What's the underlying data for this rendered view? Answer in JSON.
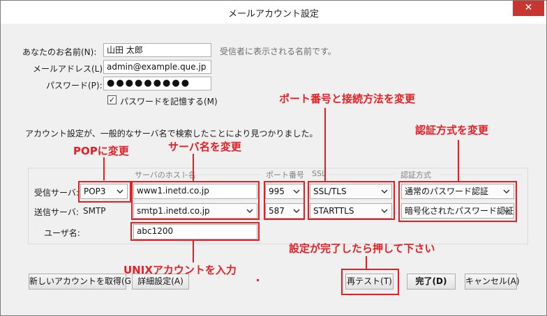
{
  "window": {
    "title": "メールアカウント設定",
    "close_glyph": "✕"
  },
  "identity": {
    "name_label": "あなたのお名前(N):",
    "name_value": "山田 太郎",
    "name_hint": "受信者に表示される名前です。",
    "email_label": "メールアドレス(L):",
    "email_value": "admin@example.que.jp",
    "password_label": "パスワード(P):",
    "password_value": "●●●●●●●●●",
    "remember_label": "パスワードを記憶する(M)",
    "remember_checked": true
  },
  "info_text": "アカウント設定が、一般的なサーバ名で検索したことにより見つかりました。",
  "server_table": {
    "headers": {
      "host": "サーバのホスト名",
      "port": "ポート番号",
      "ssl": "SSL",
      "auth": "認証方式"
    },
    "incoming": {
      "label": "受信サーバ:",
      "protocol": "POP3",
      "host": "www1.inetd.co.jp",
      "port": "995",
      "ssl": "SSL/TLS",
      "auth": "通常のパスワード認証"
    },
    "outgoing": {
      "label": "送信サーバ:",
      "protocol": "SMTP",
      "host": "smtp1.inetd.co.jp",
      "port": "587",
      "ssl": "STARTTLS",
      "auth": "暗号化されたパスワード認証"
    },
    "username_label": "ユーザ名:",
    "username_value": "abc1200"
  },
  "buttons": {
    "new_account": "新しいアカウントを取得(G)",
    "advanced": "詳細設定(A)",
    "retest": "再テスト(T)",
    "done": "完了(D)",
    "cancel": "キャンセル(A)"
  },
  "annotations": {
    "pop": "POPに変更",
    "server_name": "サーバ名を変更",
    "port_method": "ポート番号と接続方法を変更",
    "auth": "認証方式を変更",
    "unix": "UNIXアカウントを入力",
    "press": "設定が完了したら押して下さい"
  },
  "colors": {
    "annotation": "#e51f24",
    "close": "#c7372f"
  }
}
